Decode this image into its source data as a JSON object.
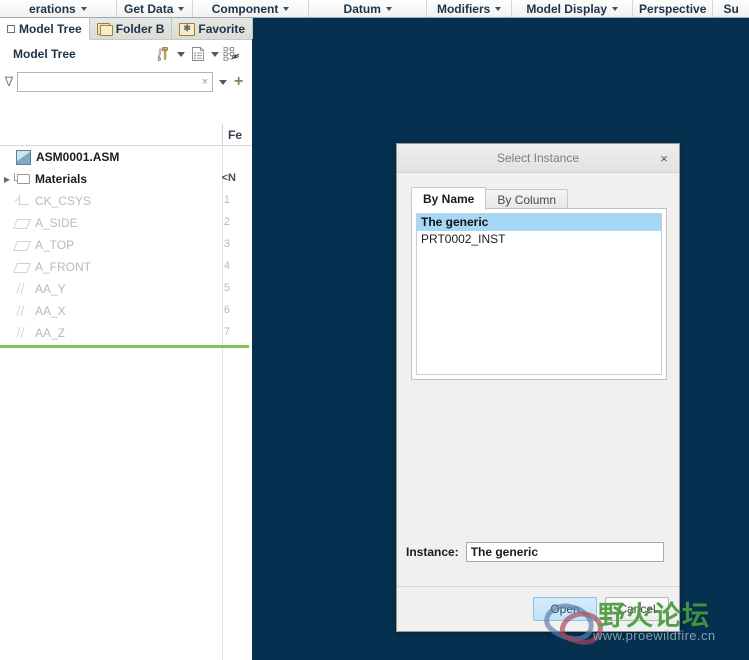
{
  "ribbon": {
    "items": [
      {
        "label": "erations",
        "caret": true
      },
      {
        "label": "Get Data",
        "caret": true
      },
      {
        "label": "Component",
        "caret": true
      },
      {
        "label": "Datum",
        "caret": true
      },
      {
        "label": "Modifiers",
        "caret": true
      },
      {
        "label": "Model Display",
        "caret": true
      },
      {
        "label": "Perspective",
        "caret": false
      },
      {
        "label": "Su",
        "caret": false
      }
    ]
  },
  "left_panel": {
    "tabs": [
      {
        "label": "Model Tree",
        "icon": "window-icon",
        "active": true
      },
      {
        "label": "Folder B",
        "icon": "folder-icon",
        "active": false
      },
      {
        "label": "Favorite",
        "icon": "favorites-folder-icon",
        "active": false
      }
    ],
    "panel_title": "Model Tree",
    "tools": [
      {
        "name": "settings-tools-icon"
      },
      {
        "name": "settings-dropdown-caret"
      },
      {
        "name": "tree-columns-icon"
      },
      {
        "name": "tree-columns-dropdown-caret"
      },
      {
        "name": "tree-filter-display-icon"
      }
    ],
    "search": {
      "value": "",
      "placeholder": "",
      "clear_label": "×",
      "filter_glyph": "∇",
      "add_label": "+"
    },
    "column_header": "Fe",
    "tree": [
      {
        "label": "ASM0001.ASM",
        "num": "",
        "icon": "assembly-icon",
        "style": "root",
        "expander": "",
        "indent": 14
      },
      {
        "label": "Materials",
        "num": "<N",
        "icon": "materials-icon",
        "style": "bold",
        "expander": "▶",
        "indent": 0
      },
      {
        "label": "CK_CSYS",
        "num": "1",
        "icon": "csys-icon",
        "style": "dim",
        "expander": "",
        "indent": 14
      },
      {
        "label": "A_SIDE",
        "num": "2",
        "icon": "plane-icon",
        "style": "dim",
        "expander": "",
        "indent": 14
      },
      {
        "label": "A_TOP",
        "num": "3",
        "icon": "plane-icon",
        "style": "dim",
        "expander": "",
        "indent": 14
      },
      {
        "label": "A_FRONT",
        "num": "4",
        "icon": "plane-icon",
        "style": "dim",
        "expander": "",
        "indent": 14
      },
      {
        "label": "AA_Y",
        "num": "5",
        "icon": "axis-icon",
        "style": "dim",
        "expander": "",
        "indent": 14
      },
      {
        "label": "AA_X",
        "num": "6",
        "icon": "axis-icon",
        "style": "dim",
        "expander": "",
        "indent": 14
      },
      {
        "label": "AA_Z",
        "num": "7",
        "icon": "axis-icon",
        "style": "dim",
        "expander": "",
        "indent": 14
      }
    ]
  },
  "dialog": {
    "title": "Select Instance",
    "close_label": "×",
    "tabs": [
      {
        "label": "By Name",
        "active": true
      },
      {
        "label": "By Column",
        "active": false
      }
    ],
    "list": [
      {
        "label": "The generic",
        "selected": true
      },
      {
        "label": "PRT0002_INST",
        "selected": false
      }
    ],
    "instance_label": "Instance:",
    "instance_value": "The generic",
    "buttons": [
      {
        "label": "Open",
        "primary": true
      },
      {
        "label": "Cancel",
        "primary": false
      }
    ]
  },
  "watermark": {
    "text": "野火论坛",
    "url": "www.proewildfire.cn"
  },
  "colors": {
    "graphics_background": "#06304f",
    "selection_blue": "#a6d8f5",
    "insert_line_green": "#7cc453",
    "watermark_green": "#4a9a3c"
  }
}
